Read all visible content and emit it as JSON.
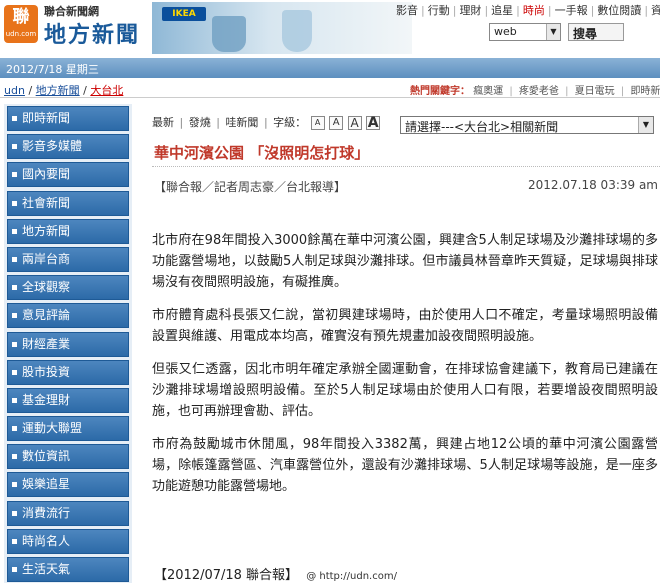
{
  "header": {
    "logo_small_icon_text": "聯",
    "logo_small_domain": "udn.com",
    "logo_line1": "聯合新聞網",
    "logo_line2": "地方新聞",
    "ad_brand": "IKEA",
    "topnav": [
      {
        "label": "影音"
      },
      {
        "label": "行動"
      },
      {
        "label": "理財"
      },
      {
        "label": "追星"
      },
      {
        "label": "時尚",
        "hot": true
      },
      {
        "label": "一手報"
      },
      {
        "label": "數位閱讀"
      },
      {
        "label": "資料"
      }
    ],
    "search": {
      "selected": "web",
      "button": "搜尋"
    }
  },
  "datebar": {
    "date": "2012/7/18 星期三"
  },
  "breadcrumb": {
    "home": "udn",
    "section": "地方新聞",
    "current": "大台北"
  },
  "hot_keywords": {
    "label": "熱門關鍵字：",
    "items": [
      "瘋奧運",
      "疼愛老爸",
      "夏日電玩",
      "即時新聞"
    ]
  },
  "sidebar": {
    "items": [
      {
        "label": "即時新聞"
      },
      {
        "label": "影音多媒體"
      },
      {
        "label": "國內要聞"
      },
      {
        "label": "社會新聞"
      },
      {
        "label": "地方新聞"
      },
      {
        "label": "兩岸台商"
      },
      {
        "label": "全球觀察"
      },
      {
        "label": "意見評論"
      },
      {
        "label": "財經產業"
      },
      {
        "label": "股市投資"
      },
      {
        "label": "基金理財"
      },
      {
        "label": "運動大聯盟"
      },
      {
        "label": "數位資訊"
      },
      {
        "label": "娛樂追星"
      },
      {
        "label": "消費流行"
      },
      {
        "label": "時尚名人"
      },
      {
        "label": "生活天氣"
      }
    ]
  },
  "toolbar": {
    "latest": "最新",
    "post": "發燒",
    "comment": "哇新聞",
    "fontsize_label": "字級：",
    "font_buttons": [
      "A",
      "A",
      "A",
      "A"
    ],
    "related_select": "請選擇---<大台北>相關新聞"
  },
  "article": {
    "headline": "華中河濱公園 「沒照明怎打球」",
    "byline": "【聯合報／記者周志豪／台北報導】",
    "timestamp": "2012.07.18 03:39 am",
    "paragraphs": [
      "北市府在98年間投入3000餘萬在華中河濱公園，興建含5人制足球場及沙灘排球場的多功能露營場地，以鼓勵5人制足球與沙灘排球。但市議員林晉章昨天質疑，足球場與排球場沒有夜間照明設施，有礙推廣。",
      "市府體育處科長張又仁說，當初興建球場時，由於使用人口不確定，考量球場照明設備設置與維護、用電成本均高，確實沒有預先規畫加設夜間照明設施。",
      "但張又仁透露，因北市明年確定承辦全國運動會，在排球協會建議下，教育局已建議在沙灘排球場增設照明設備。至於5人制足球場由於使用人口有限，若要增設夜間照明設施，也可再辦理會勘、評估。",
      "市府為鼓勵城市休閒風，98年間投入3382萬，興建占地12公頃的華中河濱公園露營場，除帳篷露營區、汽車露營位外，還設有沙灘排球場、5人制足球場等設施，是一座多功能遊憩功能露營場地。"
    ],
    "source": "【2012/07/18 聯合報】",
    "source_url": "@ http://udn.com/"
  }
}
